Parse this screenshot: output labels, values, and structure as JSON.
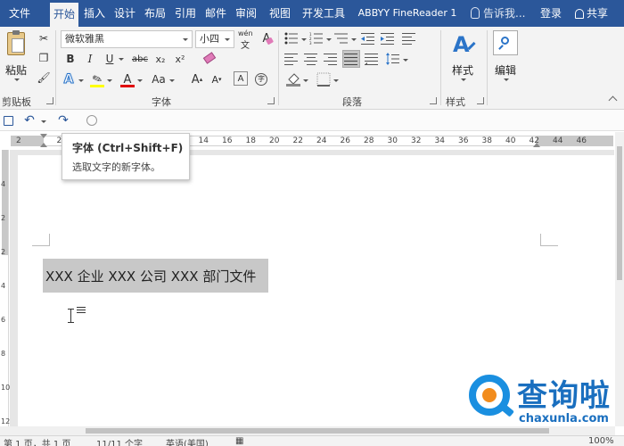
{
  "tabs": [
    {
      "label": "文件",
      "active": false
    },
    {
      "label": "开始",
      "active": true
    },
    {
      "label": "插入",
      "active": false
    },
    {
      "label": "设计",
      "active": false
    },
    {
      "label": "布局",
      "active": false
    },
    {
      "label": "引用",
      "active": false
    },
    {
      "label": "邮件",
      "active": false
    },
    {
      "label": "审阅",
      "active": false
    },
    {
      "label": "视图",
      "active": false
    },
    {
      "label": "开发工具",
      "active": false
    },
    {
      "label": "ABBYY FineReader 1",
      "active": false
    }
  ],
  "tell_me": "告诉我...",
  "login": "登录",
  "share": "共享",
  "ribbon": {
    "clipboard": {
      "paste": "粘贴",
      "group": "剪贴板"
    },
    "font": {
      "font_name": "微软雅黑",
      "font_size": "小四",
      "phonetic_glyph": "wén",
      "group": "字体",
      "bold": "B",
      "italic": "I",
      "underline": "U",
      "strike": "abc",
      "sub": "x₂",
      "sup": "x²",
      "case": "Aa",
      "grow": "A",
      "shrink": "A",
      "char_border": "A"
    },
    "paragraph": {
      "group": "段落"
    },
    "styles": {
      "button": "样式",
      "group": "样式"
    },
    "editing": {
      "button": "编辑"
    }
  },
  "ruler": {
    "ticks": [
      "2",
      "2",
      "4",
      "6",
      "8",
      "10",
      "12",
      "14",
      "16",
      "18",
      "20",
      "22",
      "24",
      "26",
      "28",
      "30",
      "32",
      "34",
      "36",
      "38",
      "40",
      "42",
      "44",
      "46"
    ],
    "vticks": [
      "4",
      "2",
      "2",
      "4",
      "6",
      "8",
      "10",
      "12"
    ]
  },
  "tooltip": {
    "title": "字体 (Ctrl+Shift+F)",
    "description": "选取文字的新字体。"
  },
  "document": {
    "selected_text": "XXX 企业 XXX 公司 XXX 部门文件"
  },
  "status": {
    "page": "第 1 页，共 1 页",
    "words": "11/11 个字",
    "language": "英语(美国)",
    "zoom": "100%"
  },
  "watermark": {
    "name": "查询啦",
    "url": "chaxunla.com"
  },
  "colors": {
    "accent": "#2b579a",
    "ribbon_bg": "#f3f3f3",
    "highlight_yellow": "#ffff00",
    "font_red": "#e00000",
    "selection_gray": "#c8c8c8",
    "watermark_blue": "#1a8fe0",
    "watermark_orange": "#f28c1c"
  }
}
